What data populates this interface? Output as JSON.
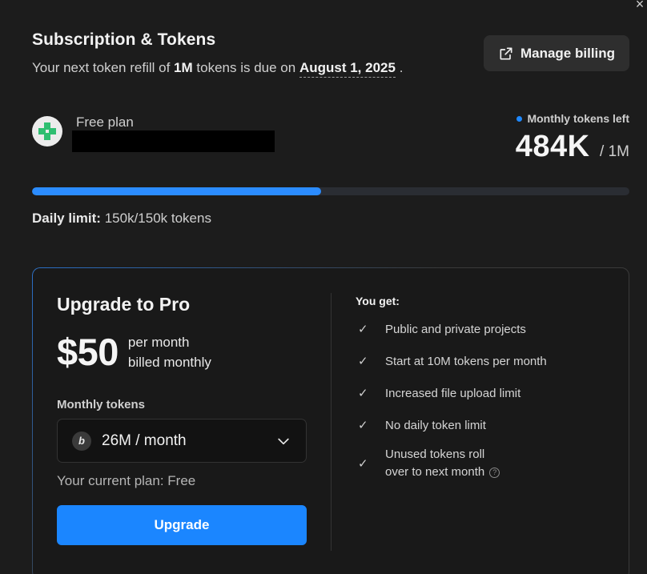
{
  "header": {
    "title": "Subscription & Tokens",
    "refill_prefix": "Your next token refill of",
    "refill_amount": "1M",
    "refill_middle": "tokens is due on",
    "refill_date": "August 1, 2025",
    "refill_suffix": "."
  },
  "manage_billing": {
    "label": "Manage billing",
    "icon": "external-link-icon"
  },
  "plan": {
    "name": "Free plan",
    "avatar_icon": "plus-badge-icon"
  },
  "tokens": {
    "label": "Monthly tokens left",
    "remaining": "484K",
    "total": "/ 1M",
    "progress_fraction": 0.484,
    "accent": "#2b8cff"
  },
  "daily": {
    "label": "Daily limit:",
    "value": "150k/150k tokens"
  },
  "upgrade": {
    "title": "Upgrade to Pro",
    "price": "$50",
    "price_line1": "per month",
    "price_line2": "billed monthly",
    "tokens_label": "Monthly tokens",
    "selected_tokens": "26M / month",
    "coin_glyph": "b",
    "current_plan": "Your current plan: Free",
    "button_label": "Upgrade",
    "button_color": "#1b86ff"
  },
  "features": {
    "heading": "You get:",
    "items": [
      "Public and private projects",
      "Start at 10M tokens per month",
      "Increased file upload limit",
      "No daily token limit"
    ],
    "last_line1": "Unused tokens roll",
    "last_line2": "over to next month"
  }
}
